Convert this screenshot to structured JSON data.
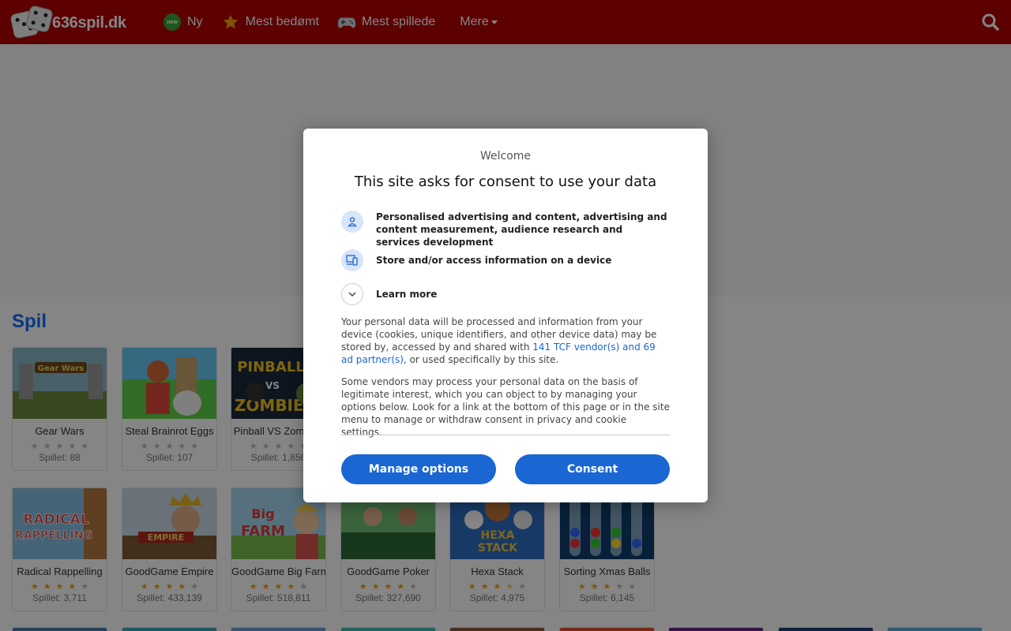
{
  "header": {
    "site_name": "636spil.dk",
    "nav": [
      {
        "label": "Ny",
        "icon": "new-badge-icon",
        "badge_text": "new"
      },
      {
        "label": "Mest bedømt",
        "icon": "star-icon"
      },
      {
        "label": "Mest spillede",
        "icon": "gamepad-icon"
      },
      {
        "label": "Mere",
        "icon": "chevron-down-icon"
      }
    ],
    "brand_color": "#b10000"
  },
  "section": {
    "title": "Spil"
  },
  "games_row1": [
    {
      "name": "Gear Wars",
      "rating": 0,
      "plays": "Spillet: 88"
    },
    {
      "name": "Steal Brainrot Eggs",
      "rating": 0,
      "plays": "Spillet: 107"
    },
    {
      "name": "Pinball VS Zombies",
      "rating": 0,
      "plays": "Spillet: 1,856"
    }
  ],
  "games_row2": [
    {
      "name": "Radical Rappelling",
      "rating": 4,
      "plays": "Spillet: 3,711"
    },
    {
      "name": "GoodGame Empire",
      "rating": 4,
      "plays": "Spillet: 433,139"
    },
    {
      "name": "GoodGame Big Farm",
      "rating": 4,
      "plays": "Spillet: 518,811"
    },
    {
      "name": "GoodGame Poker",
      "rating": 4,
      "plays": "Spillet: 327,690"
    },
    {
      "name": "Hexa Stack",
      "rating": 3.5,
      "plays": "Spillet: 4,975"
    },
    {
      "name": "Sorting Xmas Balls",
      "rating": 3,
      "plays": "Spillet: 6,145"
    }
  ],
  "consent": {
    "welcome": "Welcome",
    "title": "This site asks for consent to use your data",
    "purposes": [
      {
        "label": "Personalised advertising and content, advertising and content measurement, audience research and services development",
        "icon": "person-icon"
      },
      {
        "label": "Store and/or access information on a device",
        "icon": "devices-icon"
      },
      {
        "label": "Learn more",
        "icon": "chevron-down-icon"
      }
    ],
    "para1_before": "Your personal data will be processed and information from your device (cookies, unique identifiers, and other device data) may be stored by, accessed by and shared with ",
    "para1_link": "141 TCF vendor(s) and 69 ad partner(s)",
    "para1_after": ", or used specifically by this site.",
    "para2": "Some vendors may process your personal data on the basis of legitimate interest, which you can object to by managing your options below. Look for a link at the bottom of this page or in the site menu to manage or withdraw consent in privacy and cookie settings.",
    "manage_label": "Manage options",
    "consent_label": "Consent",
    "button_color": "#1a66d2"
  }
}
